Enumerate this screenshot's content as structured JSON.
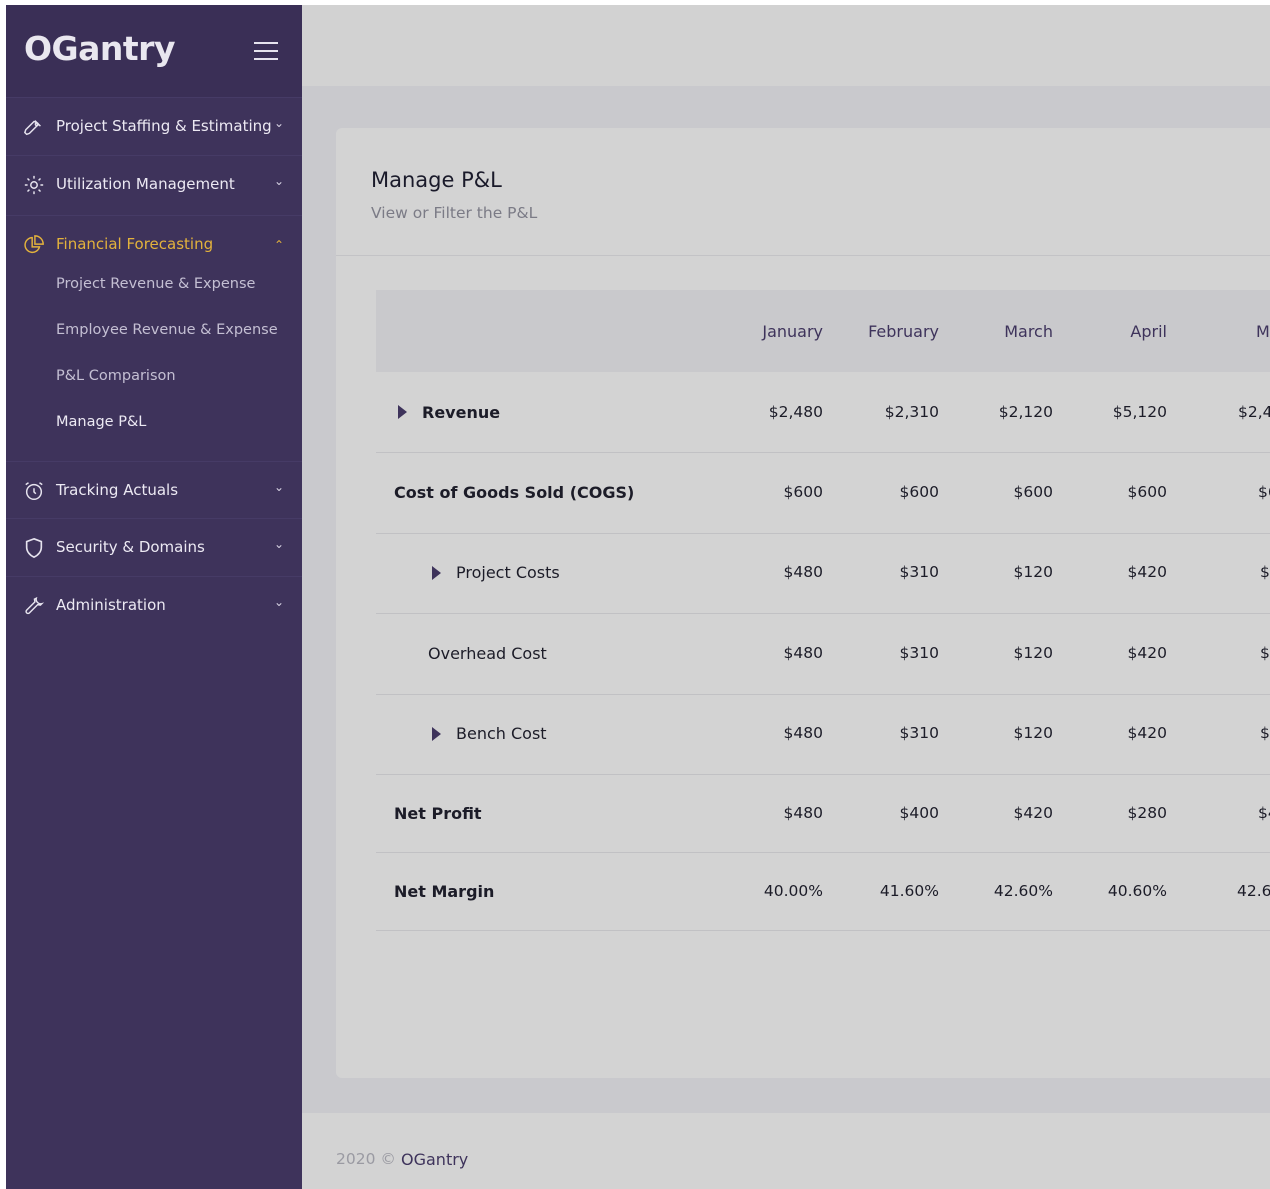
{
  "sidebar": {
    "logo": "OGantry",
    "items": [
      {
        "label": "Project Staffing & Estimating",
        "icon": "rocket-icon"
      },
      {
        "label": "Utilization Management",
        "icon": "gear-icon"
      },
      {
        "label": "Financial Forecasting",
        "icon": "pie-chart-icon",
        "active": true
      },
      {
        "label": "Tracking Actuals",
        "icon": "alarm-clock-icon"
      },
      {
        "label": "Security & Domains",
        "icon": "shield-icon"
      },
      {
        "label": "Administration",
        "icon": "wrench-icon"
      }
    ],
    "subitems": [
      {
        "label": "Project Revenue & Expense"
      },
      {
        "label": "Employee Revenue & Expense"
      },
      {
        "label": "P&L Comparison"
      },
      {
        "label": "Manage P&L",
        "current": true
      }
    ]
  },
  "page": {
    "title": "Manage P&L",
    "subtitle": "View or Filter the P&L"
  },
  "table": {
    "columns": [
      "January",
      "February",
      "March",
      "April",
      "M"
    ],
    "rows": [
      {
        "label": "Revenue",
        "values": [
          "$2,480",
          "$2,310",
          "$2,120",
          "$5,120",
          "$2,4"
        ]
      },
      {
        "label": "Cost of Goods Sold (COGS)",
        "values": [
          "$600",
          "$600",
          "$600",
          "$600",
          "$6"
        ]
      },
      {
        "label": "Project Costs",
        "values": [
          "$480",
          "$310",
          "$120",
          "$420",
          "$1"
        ]
      },
      {
        "label": "Overhead Cost",
        "values": [
          "$480",
          "$310",
          "$120",
          "$420",
          "$1"
        ]
      },
      {
        "label": "Bench Cost",
        "values": [
          "$480",
          "$310",
          "$120",
          "$420",
          "$1"
        ]
      },
      {
        "label": "Net Profit",
        "values": [
          "$480",
          "$400",
          "$420",
          "$280",
          "$4"
        ]
      },
      {
        "label": "Net Margin",
        "values": [
          "40.00%",
          "41.60%",
          "42.60%",
          "40.60%",
          "42.6"
        ]
      }
    ]
  },
  "footer": {
    "year": "2020 ©",
    "brand": "OGantry"
  },
  "colors": {
    "sidebar": "#3e335b",
    "accent": "#e3b23c"
  }
}
